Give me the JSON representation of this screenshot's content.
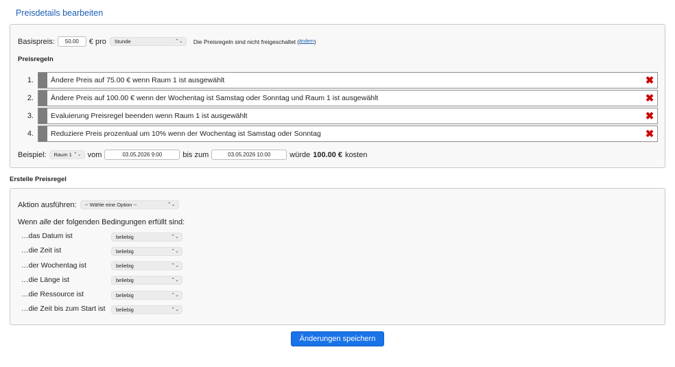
{
  "page_title": "Preisdetails bearbeiten",
  "base_price": {
    "label": "Basispreis:",
    "value": "50.00",
    "unit_text": "€ pro",
    "period_selected": "Stunde",
    "status_text": "Die Preisregeln sind nicht freigeschaltet",
    "change_link": "ändern"
  },
  "rules_section": {
    "title": "Preisregeln",
    "rules": [
      {
        "number": "1.",
        "text": "Ändere Preis auf 75.00 € wenn Raum 1 ist ausgewählt"
      },
      {
        "number": "2.",
        "text": "Ändere Preis auf 100.00 € wenn der Wochentag ist Samstag oder Sonntag und Raum 1 ist ausgewählt"
      },
      {
        "number": "3.",
        "text": "Evaluierung Preisregel beenden wenn Raum 1 ist ausgewählt"
      },
      {
        "number": "4.",
        "text": "Reduziere Preis prozentual um 10% wenn der Wochentag ist Samstag oder Sonntag"
      }
    ],
    "delete_glyph": "✖"
  },
  "example": {
    "label": "Beispiel:",
    "resource_selected": "Raum 1",
    "from_label": "vom",
    "from_value": "03.05.2026 9:00",
    "to_label": "bis zum",
    "to_value": "03.05.2026 10:00",
    "result_prefix": "würde",
    "result_amount": "100.00 €",
    "result_suffix": "kosten"
  },
  "create_section": {
    "title": "Erstelle Preisregel",
    "action_label": "Aktion ausführen:",
    "action_selected": "-- Wähle eine Option --",
    "conditions_intro_pre": "Wenn",
    "conditions_intro_em": "alle",
    "conditions_intro_post": "der folgenden Bedingungen erfüllt sind:",
    "conditions": [
      {
        "label": "…das Datum ist",
        "selected": "beliebig"
      },
      {
        "label": "…die Zeit ist",
        "selected": "beliebig"
      },
      {
        "label": "…der Wochentag ist",
        "selected": "beliebig"
      },
      {
        "label": "…die Länge ist",
        "selected": "beliebig"
      },
      {
        "label": "…die Ressource ist",
        "selected": "beliebig"
      },
      {
        "label": "…die Zeit bis zum Start ist",
        "selected": "beliebig"
      }
    ]
  },
  "save_button": "Änderungen speichern",
  "colors": {
    "accent": "#1a73e8",
    "title_blue": "#1a5fb4",
    "delete_red": "#cc0000",
    "handle_gray": "#7d7d7d"
  },
  "icons": {
    "select_arrow": "chevron-up-down-icon",
    "delete": "close-x-icon",
    "drag": "drag-handle-icon"
  }
}
